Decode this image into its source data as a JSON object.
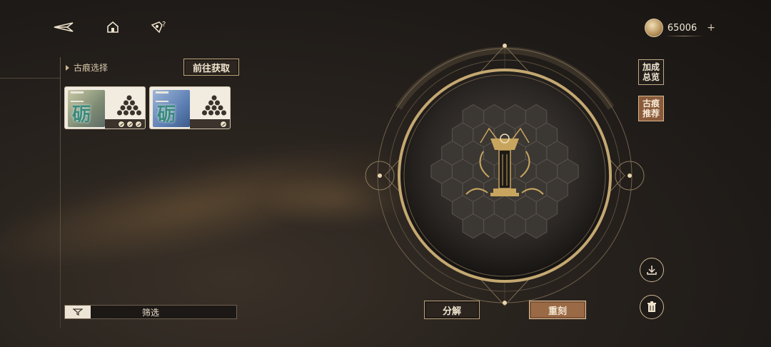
{
  "topbar": {
    "back_icon": "back-arrow-icon",
    "home_icon": "home-icon",
    "help_icon": "help-icon",
    "currency": {
      "icon": "coin-icon",
      "amount": "65006",
      "plus": "+"
    }
  },
  "left_panel": {
    "section_title": "古痕选择",
    "goto_button": "前往获取",
    "cards": [
      {
        "name": "trace-card-1",
        "glyph": "砺",
        "theme": "gold-green",
        "badges": 3
      },
      {
        "name": "trace-card-2",
        "glyph": "砺",
        "theme": "blue",
        "badges": 1
      }
    ],
    "filter": {
      "icon": "filter-icon",
      "label": "筛选"
    }
  },
  "right_panel": {
    "bonus_overview": "加成总览",
    "trace_recommend": "古痕推荐",
    "save_icon": "download-icon",
    "delete_icon": "trash-icon"
  },
  "actions": {
    "split": "分解",
    "recarve": "重刻"
  },
  "colors": {
    "accent_gold": "#c8b189",
    "copper": "#9a6a47",
    "background": "#221d19"
  }
}
